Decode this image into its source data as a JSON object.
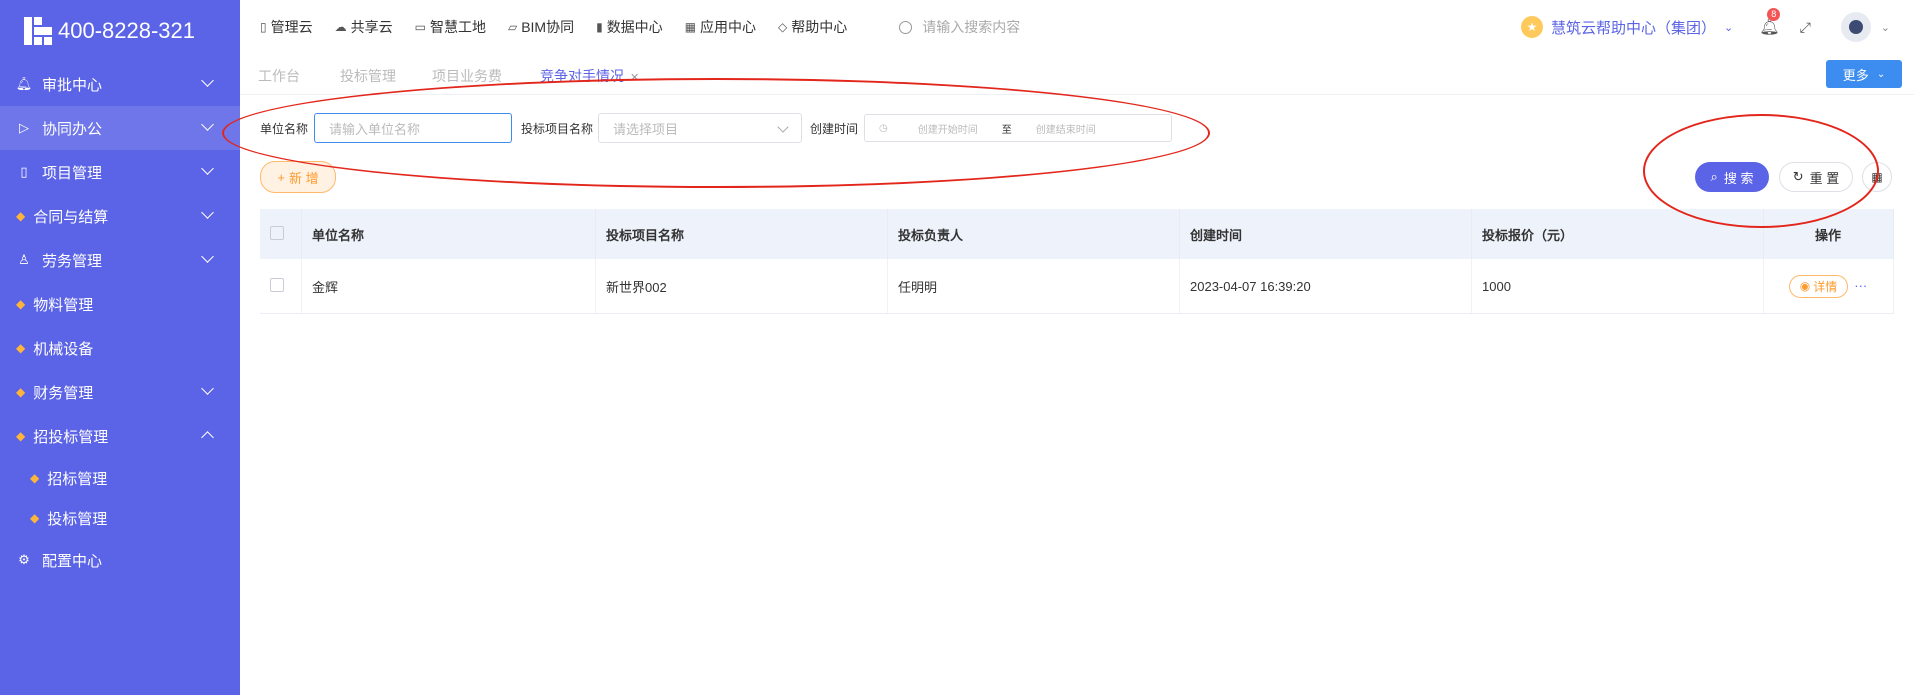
{
  "app": {
    "phone": "400-8228-321"
  },
  "sidebar": {
    "items": [
      {
        "label": "审批中心",
        "icon": "bell-icon",
        "expanded": false
      },
      {
        "label": "协同办公",
        "icon": "send-icon",
        "expanded": false
      },
      {
        "label": "项目管理",
        "icon": "book-icon",
        "expanded": false
      },
      {
        "label": "合同与结算",
        "icon": "gem-icon",
        "expanded": false
      },
      {
        "label": "劳务管理",
        "icon": "user-icon",
        "expanded": false
      },
      {
        "label": "物料管理",
        "icon": "gem-icon"
      },
      {
        "label": "机械设备",
        "icon": "gem-icon"
      },
      {
        "label": "财务管理",
        "icon": "gem-icon",
        "expanded": false
      },
      {
        "label": "招投标管理",
        "icon": "gem-icon",
        "expanded": true
      },
      {
        "label": "配置中心",
        "icon": "gear-icon"
      }
    ],
    "subitems": [
      {
        "label": "招标管理"
      },
      {
        "label": "投标管理"
      }
    ]
  },
  "topnav": {
    "items": [
      {
        "label": "管理云"
      },
      {
        "label": "共享云"
      },
      {
        "label": "智慧工地"
      },
      {
        "label": "BIM协同"
      },
      {
        "label": "数据中心"
      },
      {
        "label": "应用中心"
      },
      {
        "label": "帮助中心"
      }
    ],
    "search_placeholder": "请输入搜索内容",
    "org_name": "慧筑云帮助中心（集团）",
    "notification_count": "8"
  },
  "tabs": [
    {
      "label": "工作台"
    },
    {
      "label": "投标管理"
    },
    {
      "label": "项目业务费"
    },
    {
      "label": "竞争对手情况"
    }
  ],
  "more_label": "更多",
  "filters": {
    "unit_label": "单位名称",
    "unit_placeholder": "请输入单位名称",
    "project_label": "投标项目名称",
    "project_placeholder": "请选择项目",
    "date_label": "创建时间",
    "date_start_placeholder": "创建开始时间",
    "date_separator": "至",
    "date_end_placeholder": "创建结束时间"
  },
  "actions": {
    "add": "新 增",
    "search": "搜 索",
    "reset": "重 置"
  },
  "table": {
    "headers": [
      "单位名称",
      "投标项目名称",
      "投标负责人",
      "创建时间",
      "投标报价（元）",
      "操作"
    ],
    "rows": [
      {
        "unit": "金辉",
        "project": "新世界002",
        "owner": "任明明",
        "created": "2023-04-07 16:39:20",
        "price": "1000",
        "action": "详情"
      }
    ]
  },
  "colors": {
    "sidebar_bg": "#5b63e6",
    "primary": "#5b63e6",
    "accent_blue": "#3d8cf0",
    "orange": "#ff9a2e",
    "annotation_red": "#e3261b"
  }
}
